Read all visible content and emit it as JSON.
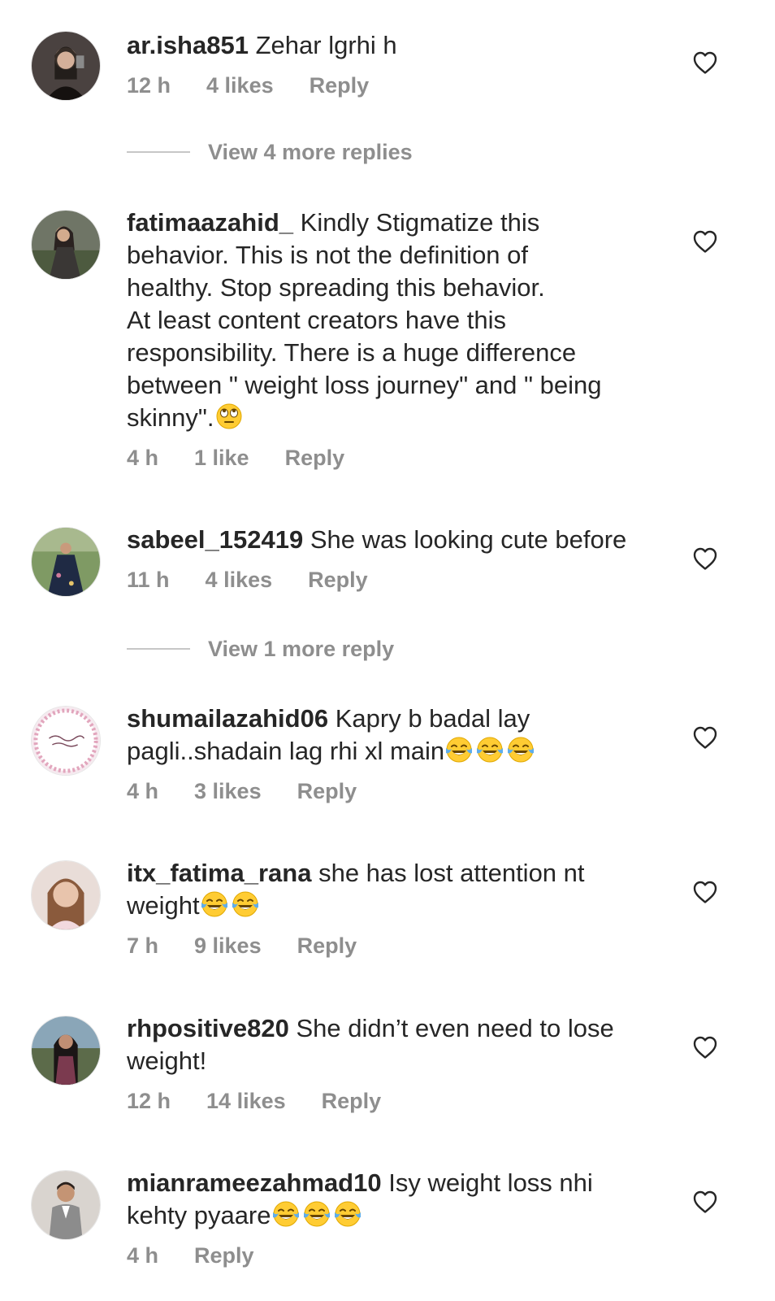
{
  "comments": [
    {
      "username": "ar.isha851",
      "text": "Zehar lgrhi h",
      "time": "12 h",
      "likes": "4 likes",
      "reply_label": "Reply"
    },
    {
      "username": "fatimaazahid_",
      "text_lines": [
        "Kindly Stigmatize this",
        "behavior. This is not the definition of",
        "healthy. Stop spreading this behavior.",
        "At least content creators have this",
        "responsibility.  There is a huge difference",
        "between \" weight loss journey\" and \" being",
        "skinny\"."
      ],
      "time": "4 h",
      "likes": "1 like",
      "reply_label": "Reply"
    },
    {
      "username": "sabeel_152419",
      "text": "She was looking cute before",
      "time": "11 h",
      "likes": "4 likes",
      "reply_label": "Reply"
    },
    {
      "username": "shumailazahid06",
      "text_line1": "Kapry b badal lay",
      "text_line2": "pagli..shadain lag rhi xl main",
      "time": "4 h",
      "likes": "3 likes",
      "reply_label": "Reply"
    },
    {
      "username": "itx_fatima_rana",
      "text_line1": "she has lost attention nt",
      "text_line2": "weight",
      "time": "7 h",
      "likes": "9 likes",
      "reply_label": "Reply"
    },
    {
      "username": "rhpositive820",
      "text_line1": "She didn’t even need to lose",
      "text_line2": "weight!",
      "time": "12 h",
      "likes": "14 likes",
      "reply_label": "Reply"
    },
    {
      "username": "mianrameezahmad10",
      "text_line1": "Isy weight loss nhi",
      "text_line2": "kehty pyaare",
      "time": "4 h",
      "reply_label": "Reply"
    }
  ],
  "view_more": [
    {
      "label": "View 4 more replies"
    },
    {
      "label": "View 1 more reply"
    }
  ],
  "colors": {
    "text": "#262626",
    "meta": "#8e8e8e",
    "divider": "#c7c7c7",
    "background": "#ffffff"
  },
  "icons": {
    "like": "heart-outline-icon",
    "emoji_rolling_eyes": "face-with-rolling-eyes-emoji",
    "emoji_tears_of_joy": "face-with-tears-of-joy-emoji"
  }
}
